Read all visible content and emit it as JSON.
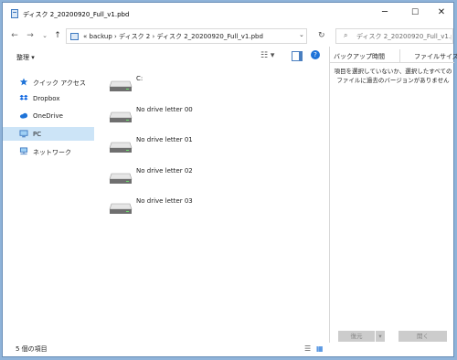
{
  "window": {
    "title": "ディスク 2_20200920_Full_v1.pbd",
    "minimize": "─",
    "maximize": "☐",
    "close": "✕"
  },
  "nav": {
    "back": "←",
    "forward": "→",
    "recent": "⌄",
    "up": "↑",
    "refresh": "↻",
    "address_dropdown": "⌄"
  },
  "address": {
    "path": "«  backup  ›  ディスク 2  ›  ディスク 2_20200920_Full_v1.pbd"
  },
  "search": {
    "placeholder": "ディスク 2_20200920_Full_v1.p..."
  },
  "toolbar": {
    "organize": "整理 ▾",
    "view_icon": "☷ ▾",
    "help": "?"
  },
  "sidebar": {
    "items": [
      {
        "label": "クイック アクセス",
        "icon": "star-icon",
        "color": "#1e73d8"
      },
      {
        "label": "Dropbox",
        "icon": "dropbox-icon",
        "color": "#0a63e0"
      },
      {
        "label": "OneDrive",
        "icon": "cloud-icon",
        "color": "#1e73d8"
      },
      {
        "label": "PC",
        "icon": "computer-icon",
        "color": "#3c8ad8"
      },
      {
        "label": "ネットワーク",
        "icon": "network-icon",
        "color": "#3c8ad8"
      }
    ],
    "selected": "PC"
  },
  "content": {
    "drives": [
      {
        "label": "C:"
      },
      {
        "label": "No drive letter 00"
      },
      {
        "label": "No drive letter 01"
      },
      {
        "label": "No drive letter 02"
      },
      {
        "label": "No drive letter 03"
      }
    ]
  },
  "preview": {
    "tab_backup": "バックアップ時間",
    "tab_filesize": "ファイルサイズ",
    "message": "項目を選択していないか、選択したすべてのファイルに過去のバージョンがありません",
    "restore_button": "復元",
    "restore_arrow": "▾",
    "open_button": "開く"
  },
  "status": {
    "item_count": "5 個の項目",
    "details_icon": "☰",
    "large_icon": "▦"
  },
  "colors": {
    "selection": "#cce4f7",
    "accent": "#1e73d8"
  }
}
